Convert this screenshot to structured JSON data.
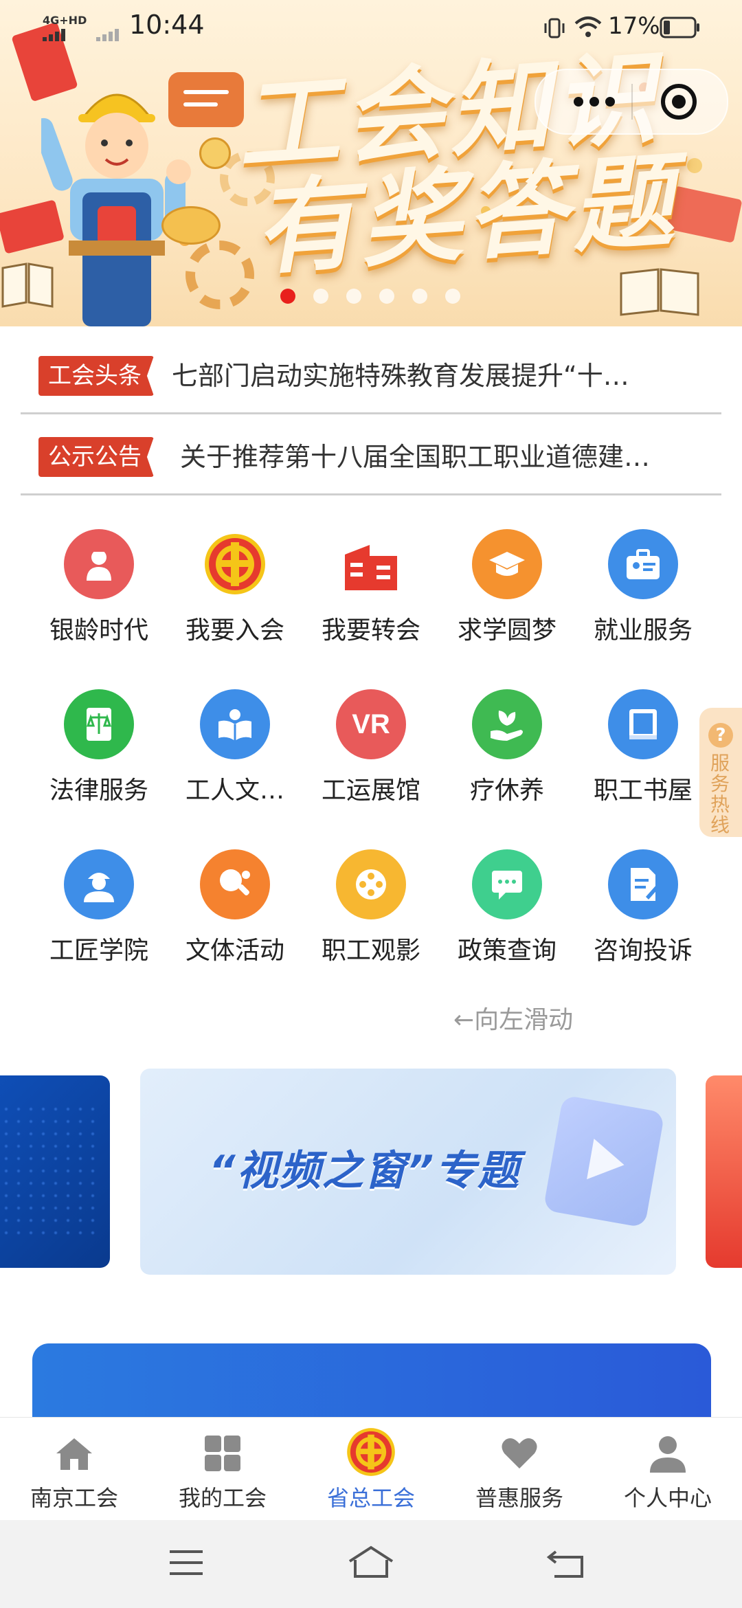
{
  "status_bar": {
    "network": "4G+HD",
    "time": "10:44",
    "battery": "17%"
  },
  "banner": {
    "title_line1": "工会知识",
    "title_line2": "有奖答题",
    "dots_total": 6,
    "dots_active": 1
  },
  "news": [
    {
      "tag": "工会头条",
      "text": "七部门启动实施特殊教育发展提升“十…"
    },
    {
      "tag": "公示公告",
      "text": "关于推荐第十八届全国职工职业道德建…"
    }
  ],
  "services": [
    {
      "label": "银龄时代",
      "icon": "elder-icon",
      "color": "#e85a5a"
    },
    {
      "label": "我要入会",
      "icon": "union-emblem-icon",
      "color": "#e63a2e"
    },
    {
      "label": "我要转会",
      "icon": "building-icon",
      "color": "#e63a2e"
    },
    {
      "label": "求学圆梦",
      "icon": "graduation-cap-icon",
      "color": "#f5922f"
    },
    {
      "label": "就业服务",
      "icon": "briefcase-icon",
      "color": "#3e8ee8"
    },
    {
      "label": "法律服务",
      "icon": "scales-icon",
      "color": "#2fb84c"
    },
    {
      "label": "工人文…",
      "icon": "book-reader-icon",
      "color": "#3e8ee8"
    },
    {
      "label": "工运展馆",
      "icon": "vr-icon",
      "color": "#e85a5a"
    },
    {
      "label": "疗休养",
      "icon": "leaf-hand-icon",
      "color": "#3fba52"
    },
    {
      "label": "职工书屋",
      "icon": "book-icon",
      "color": "#3e8ee8"
    },
    {
      "label": "工匠学院",
      "icon": "craftsman-icon",
      "color": "#3e8ee8"
    },
    {
      "label": "文体活动",
      "icon": "ping-pong-icon",
      "color": "#f5822f"
    },
    {
      "label": "职工观影",
      "icon": "film-reel-icon",
      "color": "#f7b731"
    },
    {
      "label": "政策查询",
      "icon": "chat-icon",
      "color": "#3fcf8e"
    },
    {
      "label": "咨询投诉",
      "icon": "document-edit-icon",
      "color": "#3e8ee8"
    }
  ],
  "swipe_hint": "←向左滑动",
  "hotline": {
    "label": "服务热线",
    "icon": "question-icon"
  },
  "feature_card": {
    "title": "“视频之窗”专题"
  },
  "tabbar": [
    {
      "label": "南京工会",
      "icon": "home-icon",
      "active": false
    },
    {
      "label": "我的工会",
      "icon": "grid-icon",
      "active": false
    },
    {
      "label": "省总工会",
      "icon": "union-emblem-icon",
      "active": true
    },
    {
      "label": "普惠服务",
      "icon": "heart-icon",
      "active": false
    },
    {
      "label": "个人中心",
      "icon": "person-icon",
      "active": false
    }
  ],
  "colors": {
    "accent": "#3a6fd8",
    "tag_red": "#d9402b",
    "tab_gray": "#8a8a8a"
  }
}
